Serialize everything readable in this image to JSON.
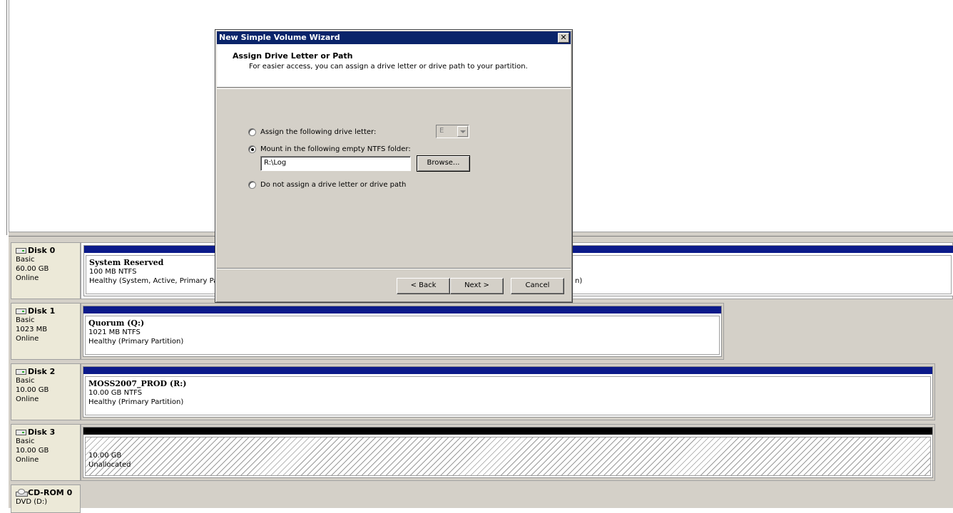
{
  "wizard": {
    "title": "New Simple Volume Wizard",
    "close_label": "✕",
    "header_title": "Assign Drive Letter or Path",
    "header_subtitle": "For easier access, you can assign a drive letter or drive path to your partition.",
    "options": [
      {
        "label": "Assign the following drive letter:",
        "checked": false
      },
      {
        "label": "Mount in the following empty NTFS folder:",
        "checked": true
      },
      {
        "label": "Do not assign a drive letter or drive path",
        "checked": false
      }
    ],
    "drive_letter_value": "E",
    "folder_path_value": "R:\\Log",
    "browse_label": "Browse...",
    "back_label": "< Back",
    "next_label": "Next >",
    "cancel_label": "Cancel"
  },
  "disks": [
    {
      "name": "Disk 0",
      "type": "Basic",
      "size": "60.00 GB",
      "status": "Online",
      "partition": {
        "name": "System Reserved",
        "details": "100 MB NTFS",
        "health": "Healthy (System, Active, Primary Par"
      },
      "trailing_text": "n)"
    },
    {
      "name": "Disk 1",
      "type": "Basic",
      "size": "1023 MB",
      "status": "Online",
      "partition": {
        "name": "Quorum  (Q:)",
        "details": "1021 MB NTFS",
        "health": "Healthy (Primary Partition)"
      }
    },
    {
      "name": "Disk 2",
      "type": "Basic",
      "size": "10.00 GB",
      "status": "Online",
      "partition": {
        "name": "MOSS2007_PROD  (R:)",
        "details": "10.00 GB NTFS",
        "health": "Healthy (Primary Partition)"
      }
    },
    {
      "name": "Disk 3",
      "type": "Basic",
      "size": "10.00 GB",
      "status": "Online",
      "partition": {
        "size": "10.00 GB",
        "state": "Unallocated"
      }
    },
    {
      "name": "CD-ROM 0",
      "type": "DVD (D:)"
    }
  ]
}
